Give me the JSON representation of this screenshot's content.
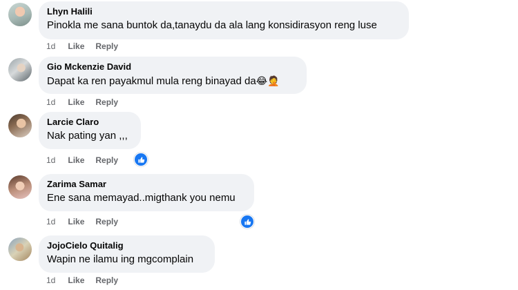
{
  "comments": [
    {
      "author": "Lhyn Halili",
      "text": "Pinokla me sana buntok da,tanaydu da ala lang konsidirasyon reng luse",
      "emoji": "",
      "time": "1d",
      "like": "Like",
      "reply": "Reply",
      "reaction": ""
    },
    {
      "author": "Gio Mckenzie David",
      "text": "Dapat ka ren payakmul mula reng binayad da",
      "emoji": "😂🤦",
      "time": "1d",
      "like": "Like",
      "reply": "Reply",
      "reaction": ""
    },
    {
      "author": "Larcie Claro",
      "text": "Nak pating yan ,,,",
      "emoji": "",
      "time": "1d",
      "like": "Like",
      "reply": "Reply",
      "reaction": "like-icon"
    },
    {
      "author": "Zarima Samar",
      "text": "Ene sana memayad..migthank you nemu",
      "emoji": "",
      "time": "1d",
      "like": "Like",
      "reply": "Reply",
      "reaction": "like-icon"
    },
    {
      "author": "JojoCielo Quitalig",
      "text": "Wapin ne ilamu ing mgcomplain",
      "emoji": "",
      "time": "1d",
      "like": "Like",
      "reply": "Reply",
      "reaction": ""
    }
  ],
  "colors": {
    "bubble": "#f0f2f5",
    "meta": "#65676b",
    "like_blue": "#1877f2"
  }
}
